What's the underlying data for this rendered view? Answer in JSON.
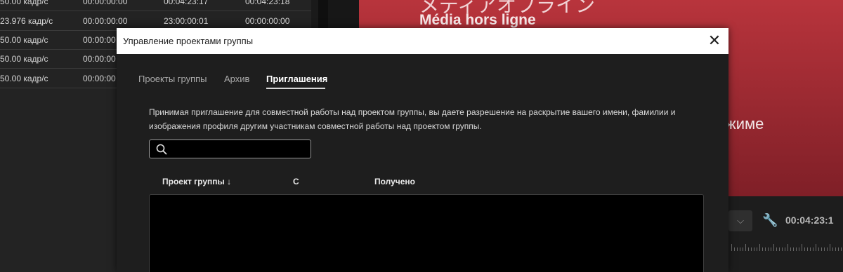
{
  "left_list": {
    "rows": [
      [
        "50.00 кадр/с",
        "00:00:00:00",
        "00:04:23:17",
        "00:04:23:18"
      ],
      [
        "23.976 кадр/с",
        "00:00:00:00",
        "23:00:00:01",
        "00:00:00:00"
      ],
      [
        "50.00 кадр/с",
        "00:00:00",
        "",
        ""
      ],
      [
        "50.00 кадр/с",
        "00:00:00",
        "",
        ""
      ],
      [
        "50.00 кадр/с",
        "00:00:00",
        "",
        ""
      ]
    ]
  },
  "monitor": {
    "line_japanese": "メディアオフライン",
    "line_french": "Média hors ligne",
    "line_mode": "ежиме",
    "timecode": "00:04:23:1",
    "background": "#a72b33"
  },
  "dialog": {
    "title": "Управление проектами группы",
    "close_glyph": "✕",
    "tabs": [
      {
        "label": "Проекты группы"
      },
      {
        "label": "Архив"
      },
      {
        "label": "Приглашения"
      }
    ],
    "active_tab": "Приглашения",
    "info_text": "Принимая приглашение для совместной работы над проектом группы, вы даете разрешение на раскрытие вашего имени, фамилии и изображения профиля другим участникам совместной работы над проектом группы.",
    "search": {
      "value": "",
      "placeholder": "",
      "icon": "search-icon"
    },
    "columns": [
      {
        "label": "Проект группы ↓"
      },
      {
        "label": "С"
      },
      {
        "label": "Получено"
      }
    ]
  }
}
